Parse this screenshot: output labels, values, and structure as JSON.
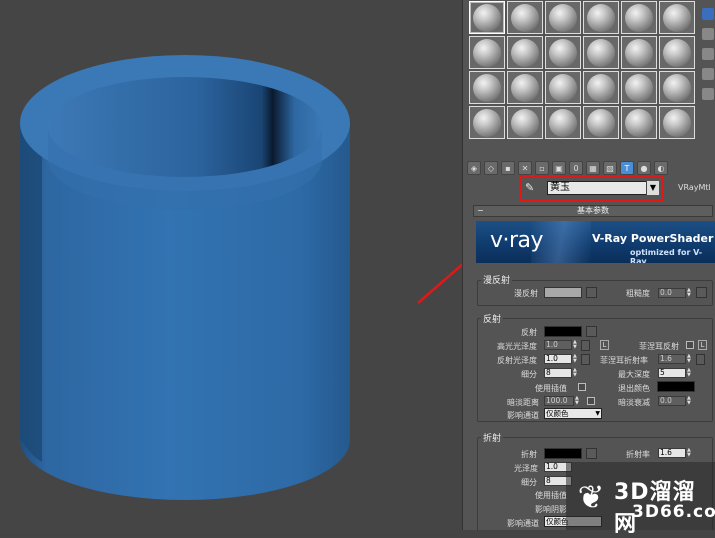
{
  "material_editor": {
    "material_name": "黄玉",
    "material_type": "VRayMtl",
    "rollout_title": "基本参数",
    "banner": {
      "logo": "v·ray",
      "title": "V-Ray PowerShader",
      "subtitle": "optimized for V-Ray"
    },
    "diffuse": {
      "group_title": "漫反射",
      "diffuse_label": "漫反射",
      "roughness_label": "粗糙度",
      "roughness_value": "0.0",
      "diffuse_color": "#a8a8a8"
    },
    "reflection": {
      "group_title": "反射",
      "reflect_label": "反射",
      "reflect_color": "#000000",
      "hilight_gloss_label": "高光光泽度",
      "hilight_gloss_value": "1.0",
      "lock_label": "L",
      "fresnel_label": "菲涅耳反射",
      "fresnel_lock_label": "L",
      "refl_gloss_label": "反射光泽度",
      "refl_gloss_value": "1.0",
      "fresnel_ior_label": "菲涅耳折射率",
      "fresnel_ior_value": "1.6",
      "subdivs_label": "细分",
      "subdivs_value": "8",
      "max_depth_label": "最大深度",
      "max_depth_value": "5",
      "use_interp_label": "使用插值",
      "exit_color_label": "退出颜色",
      "exit_color": "#000000",
      "dim_distance_label": "暗淡距离",
      "dim_distance_value": "100.0",
      "dim_falloff_label": "暗淡衰减",
      "dim_falloff_value": "0.0",
      "affect_channels_label": "影响通道",
      "affect_channels_value": "仅颜色"
    },
    "refraction": {
      "group_title": "折射",
      "refract_label": "折射",
      "refract_color": "#000000",
      "ior_label": "折射率",
      "ior_value": "1.6",
      "gloss_label": "光泽度",
      "gloss_value": "1.0",
      "subdivs_label": "细分",
      "subdivs_value": "8",
      "use_interp_label": "使用插值",
      "affect_shadows_label": "影响阴影",
      "affect_channels_label": "影响通道",
      "affect_channels_value": "仅颜色"
    }
  },
  "viewport": {
    "object_color": "#2f6aa3"
  },
  "watermark": {
    "brand": "3D溜溜网",
    "domain": "3D66.com"
  },
  "colors": {
    "highlight_box": "#e01818",
    "arrow": "#e01818",
    "panel_bg": "#545454",
    "viewport_bg": "#454545"
  }
}
